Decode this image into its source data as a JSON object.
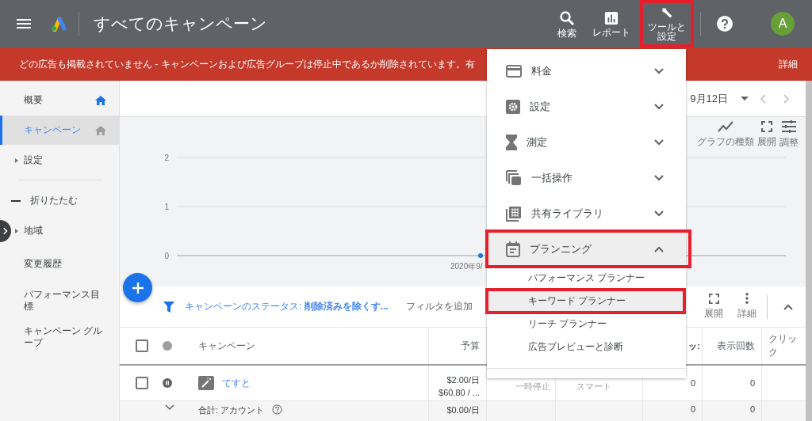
{
  "top_bar": {
    "title": "すべてのキャンペーン",
    "actions": [
      {
        "label": "検索",
        "highlighted": false
      },
      {
        "label": "レポート",
        "highlighted": false
      },
      {
        "label": "ツールと設定",
        "highlighted": true
      }
    ],
    "avatar": "A"
  },
  "banner": {
    "message": "どの広告も掲載されていません - キャンペーンおよび広告グループは停止中であるか削除されています。有",
    "link": "詳細"
  },
  "sidebar": {
    "items": [
      {
        "kind": "link",
        "label": "概要",
        "selected": false,
        "home_icon": true
      },
      {
        "kind": "link",
        "label": "キャンペーン",
        "selected": true,
        "home_icon": true
      },
      {
        "kind": "expand",
        "label": "設定",
        "selected": false,
        "home_icon": false
      },
      {
        "kind": "divider"
      },
      {
        "kind": "collapse",
        "label": "折りたたむ",
        "selected": false,
        "home_icon": false
      },
      {
        "kind": "expand",
        "label": "地域",
        "selected": false,
        "home_icon": false
      },
      {
        "kind": "link",
        "label": "変更履歴",
        "selected": false,
        "home_icon": false
      },
      {
        "kind": "link",
        "label": "パフォーマンス目標",
        "selected": false,
        "home_icon": false
      },
      {
        "kind": "link",
        "label": "キャンペーン グループ",
        "selected": false,
        "home_icon": false
      }
    ]
  },
  "date_bar": {
    "date": "9月12日"
  },
  "chart_tools": [
    "グラフの種類",
    "展開",
    "調整"
  ],
  "chart": {
    "chart_data": {
      "type": "line",
      "categories": [
        "2020年9/"
      ],
      "yticks": [
        0,
        1,
        2
      ],
      "ylim": [
        0,
        2
      ],
      "series": [
        {
          "color": "#1a73e8",
          "marker": true,
          "values": [
            0
          ]
        }
      ]
    }
  },
  "filter_bar": {
    "filter": "キャンペーンのステータス: **削除済みを除くす...**",
    "add_filter": "フィルタを追加",
    "tools": [
      "展開",
      "詳細"
    ]
  },
  "table": {
    "select_all_checked": false,
    "columns": [
      "キャンペーン",
      "予算",
      "ッ:",
      "表示回数",
      "クリック"
    ],
    "rows": [
      {
        "checked": false,
        "name": "てすと",
        "budget": [
          "$2.00/日",
          "$60.80 / ..."
        ],
        "status": "一時停止",
        "type": "スマート",
        "values": [
          "0",
          "0"
        ]
      }
    ],
    "total": {
      "label": "合計: アカウント",
      "budget": "$0.00/日",
      "values": [
        "0",
        "0"
      ]
    }
  },
  "menu": {
    "items": [
      {
        "label": "料金",
        "expanded": false,
        "highlighted": false
      },
      {
        "label": "設定",
        "expanded": false,
        "highlighted": false
      },
      {
        "label": "測定",
        "expanded": false,
        "highlighted": false
      },
      {
        "label": "一括操作",
        "expanded": false,
        "highlighted": false
      },
      {
        "label": "共有ライブラリ",
        "expanded": false,
        "highlighted": false
      },
      {
        "label": "プランニング",
        "expanded": true,
        "highlighted": true,
        "children": [
          {
            "label": "パフォーマンス プランナー",
            "selected": false,
            "highlighted": false
          },
          {
            "label": "キーワード プランナー",
            "selected": true,
            "highlighted": true
          },
          {
            "label": "リーチ プランナー",
            "selected": false,
            "highlighted": false
          },
          {
            "label": "広告プレビューと診断",
            "selected": false,
            "highlighted": false
          }
        ]
      }
    ]
  }
}
